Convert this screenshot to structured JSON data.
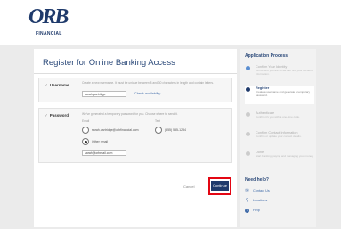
{
  "brand": {
    "logo_mark": "ORB",
    "logo_sub": "FINANCIAL"
  },
  "main": {
    "title": "Register for Online Banking Access",
    "username": {
      "heading": "Username",
      "check": "✓",
      "description": "Create a new username. It must be unique between 8 and 30 characters in length and contain letters.",
      "value": "sarah.partridge",
      "check_link": "Check availability"
    },
    "password": {
      "heading": "Password",
      "check": "✓",
      "description": "We've generated a temporary password for you. Choose where to send it.",
      "email_label": "Email",
      "text_label": "Text",
      "email_option": "sarah.partridge@orbfinancial.com",
      "other_email_label": "Other email",
      "other_email_value": "sarah@orbmail.com",
      "text_option": "(555) 555-1234"
    },
    "cancel_label": "Cancel",
    "continue_label": "Continue"
  },
  "sidebar": {
    "title": "Application Process",
    "steps": [
      {
        "name": "Confirm Your Identity",
        "desc": "Tell us who you are so we can find your account information.",
        "state": "done"
      },
      {
        "name": "Register",
        "desc": "Create a username and generate a temporary password.",
        "state": "active"
      },
      {
        "name": "Authenticate",
        "desc": "Confirm it's you with a one-time code.",
        "state": "todo"
      },
      {
        "name": "Confirm Contact Information",
        "desc": "Confirm or update your contact details.",
        "state": "todo"
      },
      {
        "name": "Done",
        "desc": "Start banking, paying and managing your money.",
        "state": "todo"
      }
    ],
    "help_title": "Need help?",
    "help_items": [
      {
        "icon": "chat-icon",
        "glyph": "✉",
        "label": "Contact Us"
      },
      {
        "icon": "location-icon",
        "glyph": "⚲",
        "label": "Locations"
      },
      {
        "icon": "help-icon",
        "glyph": "?",
        "label": "Help"
      }
    ]
  },
  "colors": {
    "brand_navy": "#1f3a6b",
    "link_blue": "#3e6aa8",
    "highlight_red": "#e30613"
  }
}
